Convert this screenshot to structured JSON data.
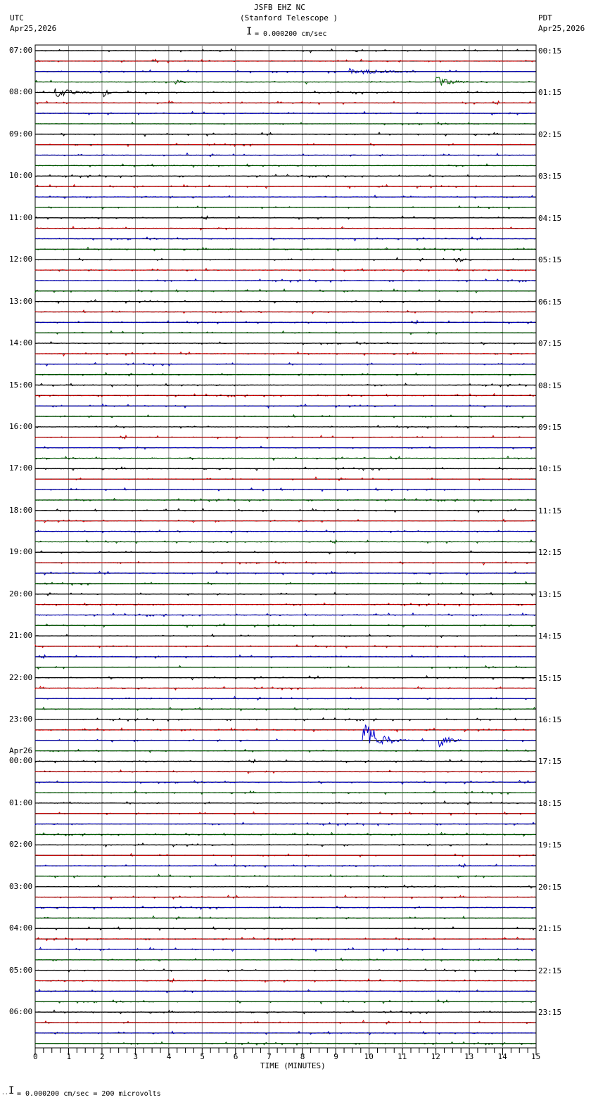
{
  "header": {
    "title": "JSFB EHZ NC",
    "subtitle": "(Stanford Telescope )",
    "left_tz": "UTC",
    "left_date": "Apr25,2026",
    "right_tz": "PDT",
    "right_date": "Apr25,2026",
    "scale_text": "= 0.000200 cm/sec"
  },
  "footer": {
    "scale_text": "= 0.000200 cm/sec =     200 microvolts",
    "scale_prefix": "··"
  },
  "chart_data": {
    "type": "line",
    "title": "JSFB EHZ NC (Stanford Telescope )",
    "xlabel": "TIME (MINUTES)",
    "xlim": [
      0,
      15
    ],
    "x_ticks": [
      "0",
      "1",
      "2",
      "3",
      "4",
      "5",
      "6",
      "7",
      "8",
      "9",
      "10",
      "11",
      "12",
      "13",
      "14",
      "15"
    ],
    "traces_per_hour": 4,
    "trace_count": 96,
    "trace_colors": [
      "#000000",
      "#dd0000",
      "#0000cc",
      "#006600"
    ],
    "left_labels": [
      {
        "row": 0,
        "text": "07:00"
      },
      {
        "row": 4,
        "text": "08:00"
      },
      {
        "row": 8,
        "text": "09:00"
      },
      {
        "row": 12,
        "text": "10:00"
      },
      {
        "row": 16,
        "text": "11:00"
      },
      {
        "row": 20,
        "text": "12:00"
      },
      {
        "row": 24,
        "text": "13:00"
      },
      {
        "row": 28,
        "text": "14:00"
      },
      {
        "row": 32,
        "text": "15:00"
      },
      {
        "row": 36,
        "text": "16:00"
      },
      {
        "row": 40,
        "text": "17:00"
      },
      {
        "row": 44,
        "text": "18:00"
      },
      {
        "row": 48,
        "text": "19:00"
      },
      {
        "row": 52,
        "text": "20:00"
      },
      {
        "row": 56,
        "text": "21:00"
      },
      {
        "row": 60,
        "text": "22:00"
      },
      {
        "row": 64,
        "text": "23:00"
      },
      {
        "row": 68,
        "text": "00:00"
      },
      {
        "row": 72,
        "text": "01:00"
      },
      {
        "row": 76,
        "text": "02:00"
      },
      {
        "row": 80,
        "text": "03:00"
      },
      {
        "row": 84,
        "text": "04:00"
      },
      {
        "row": 88,
        "text": "05:00"
      },
      {
        "row": 92,
        "text": "06:00"
      }
    ],
    "date_change_label": "Apr26",
    "right_labels": [
      "00:15",
      "01:15",
      "02:15",
      "03:15",
      "04:15",
      "05:15",
      "06:15",
      "07:15",
      "08:15",
      "09:15",
      "10:15",
      "11:15",
      "12:15",
      "13:15",
      "14:15",
      "15:15",
      "16:15",
      "17:15",
      "18:15",
      "19:15",
      "20:15",
      "21:15",
      "22:15",
      "23:15"
    ],
    "events": [
      {
        "row": 2,
        "start_min": 9.4,
        "end_min": 11.4,
        "amplitude": 4
      },
      {
        "row": 3,
        "start_min": 4.2,
        "end_min": 4.6,
        "amplitude": 4
      },
      {
        "row": 3,
        "start_min": 12.0,
        "end_min": 13.0,
        "amplitude": 8
      },
      {
        "row": 4,
        "start_min": 0.6,
        "end_min": 1.8,
        "amplitude": 6
      },
      {
        "row": 4,
        "start_min": 2.05,
        "end_min": 2.3,
        "amplitude": 12
      },
      {
        "row": 5,
        "start_min": 4.0,
        "end_min": 4.2,
        "amplitude": 3
      },
      {
        "row": 20,
        "start_min": 12.6,
        "end_min": 13.2,
        "amplitude": 3
      },
      {
        "row": 66,
        "start_min": 9.8,
        "end_min": 11.2,
        "amplitude": 28
      },
      {
        "row": 66,
        "start_min": 12.1,
        "end_min": 12.8,
        "amplitude": 10
      }
    ]
  }
}
